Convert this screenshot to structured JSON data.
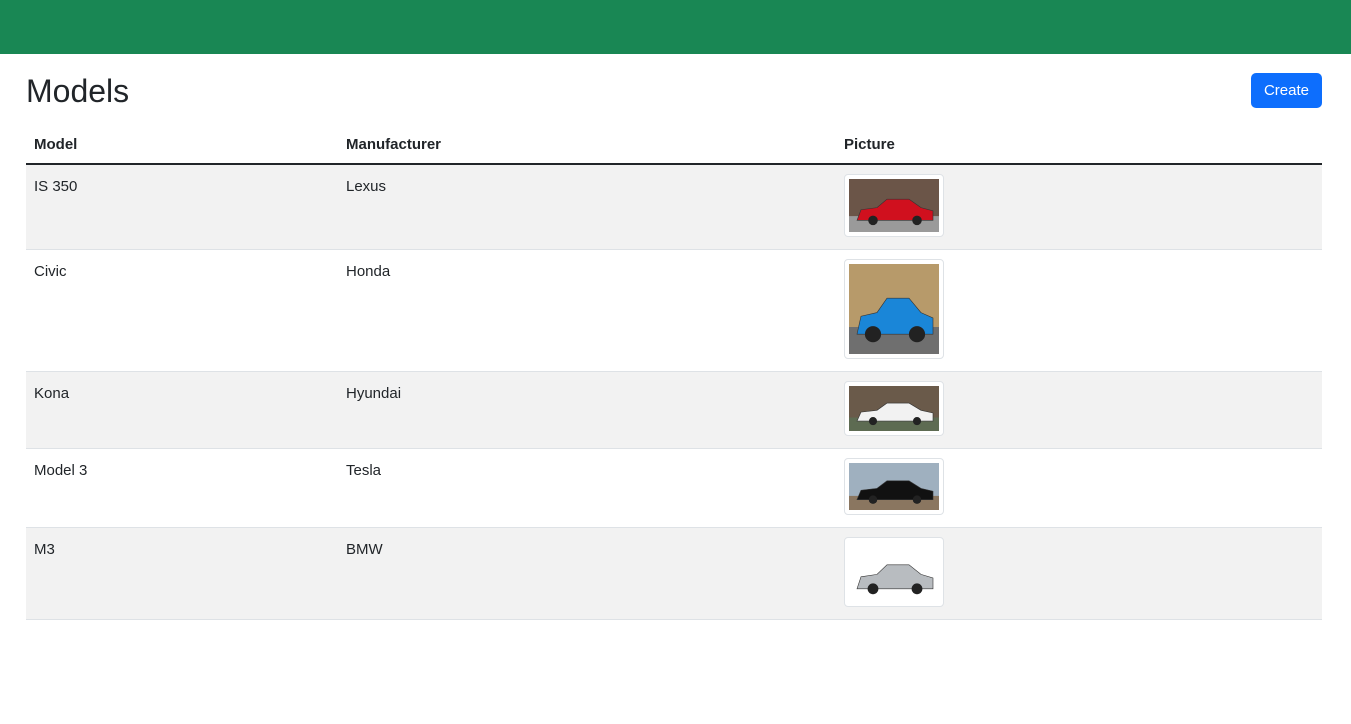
{
  "header": {
    "title": "Models",
    "create_label": "Create"
  },
  "table": {
    "columns": [
      "Model",
      "Manufacturer",
      "Picture"
    ],
    "rows": [
      {
        "model": "IS 350",
        "manufacturer": "Lexus",
        "car_color": "#d0101e",
        "bg": "#6b5548",
        "ground": "#9a9a9a",
        "img_h": 53
      },
      {
        "model": "Civic",
        "manufacturer": "Honda",
        "car_color": "#1a86d8",
        "bg": "#b79a6a",
        "ground": "#6f6f6f",
        "img_h": 90
      },
      {
        "model": "Kona",
        "manufacturer": "Hyundai",
        "car_color": "#f2f2f2",
        "bg": "#6a5a4a",
        "ground": "#5d6b52",
        "img_h": 45
      },
      {
        "model": "Model 3",
        "manufacturer": "Tesla",
        "car_color": "#111111",
        "bg": "#9fb0bf",
        "ground": "#8a7660",
        "img_h": 47
      },
      {
        "model": "M3",
        "manufacturer": "BMW",
        "car_color": "#b8bcc0",
        "bg": "#ffffff",
        "ground": "#ffffff",
        "img_h": 60
      }
    ]
  }
}
